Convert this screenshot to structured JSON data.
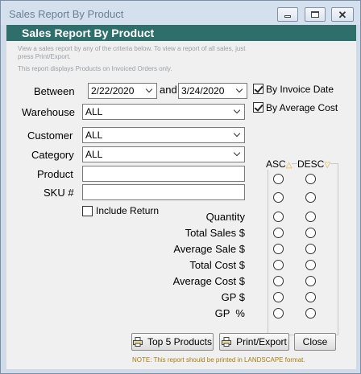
{
  "window": {
    "title": "Sales Report By Product",
    "controls": [
      "minimize-icon",
      "maximize-icon",
      "close-icon"
    ]
  },
  "header": {
    "title": "Sales Report By Product"
  },
  "description": {
    "line1": "View a sales report by any of the criteria below.  To view a report of all sales, just",
    "line2": "press Print/Export.",
    "line3": "This report displays Products on Invoiced Orders only."
  },
  "filters": {
    "between_label": "Between",
    "start_date": "2/22/2020",
    "and_label": "and",
    "end_date": "3/24/2020",
    "by_invoice_date": {
      "label": "By Invoice Date",
      "checked": true
    },
    "by_average_cost": {
      "label": "By Average Cost",
      "checked": true
    },
    "warehouse_label": "Warehouse",
    "warehouse_value": "ALL",
    "customer_label": "Customer",
    "customer_value": "ALL",
    "category_label": "Category",
    "category_value": "ALL",
    "product_label": "Product",
    "product_value": "",
    "sku_label": "SKU #",
    "sku_value": "",
    "include_return": {
      "label": "Include Return",
      "checked": false
    }
  },
  "sort": {
    "asc_label": "ASC",
    "desc_label": "DESC",
    "arrow_up": "△",
    "arrow_down": "▽",
    "rows": [
      {
        "label": ""
      },
      {
        "label": "Quantity"
      },
      {
        "label": "Total Sales $"
      },
      {
        "label": "Average Sale $"
      },
      {
        "label": "Total Cost $"
      },
      {
        "label": "Average Cost $"
      },
      {
        "label": "GP $"
      },
      {
        "label": "GP  %"
      }
    ]
  },
  "buttons": {
    "top5": "Top 5 Products",
    "print_export": "Print/Export",
    "close": "Close"
  },
  "note": "NOTE: This report should be printed in LANDSCAPE format.",
  "colors": {
    "header_bg": "#2e6f6b",
    "note_text": "#a87c16",
    "arrow": "#e0b030"
  }
}
